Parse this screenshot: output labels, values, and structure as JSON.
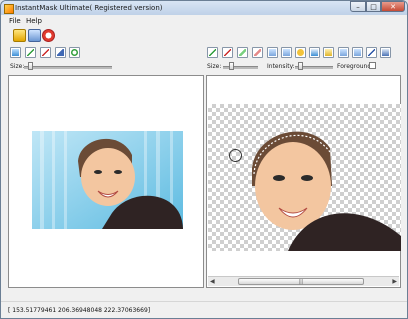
{
  "window": {
    "title": "InstantMask Ultimate( Registered version)",
    "controls": {
      "minimize": "–",
      "maximize": "□",
      "close": "✕"
    }
  },
  "menu": {
    "items": [
      "File",
      "Help"
    ]
  },
  "toolbar_main": [
    "open-icon",
    "save-icon",
    "help-lifebuoy-icon"
  ],
  "left_tools": [
    "select-tool-icon",
    "green-brush-icon",
    "red-brush-icon",
    "eraser-icon",
    "refresh-icon"
  ],
  "left_controls": {
    "size_label": "Size:",
    "size_value": 0.05
  },
  "right_tools": [
    "green-pen-icon",
    "red-pen-icon",
    "green-marker-icon",
    "red-marker-icon",
    "mask-icon",
    "mask-icon",
    "color-icon",
    "restore-icon",
    "mask-icon",
    "mask-icon",
    "mask-icon",
    "blue-brush-icon",
    "layers-icon"
  ],
  "right_controls": {
    "size_label": "Size:",
    "intensity_label": "Intensity:",
    "foreground_label": "Foreground:",
    "size_value": 0.2,
    "intensity_value": 0.1,
    "foreground_checked": false
  },
  "status": {
    "coords": "[ 153.51779461  206.36948048  222.37063669]"
  },
  "colors": {
    "accent": "#3c8fd6",
    "mask_green": "#2e9d3a",
    "mask_red": "#cc2a2a"
  }
}
